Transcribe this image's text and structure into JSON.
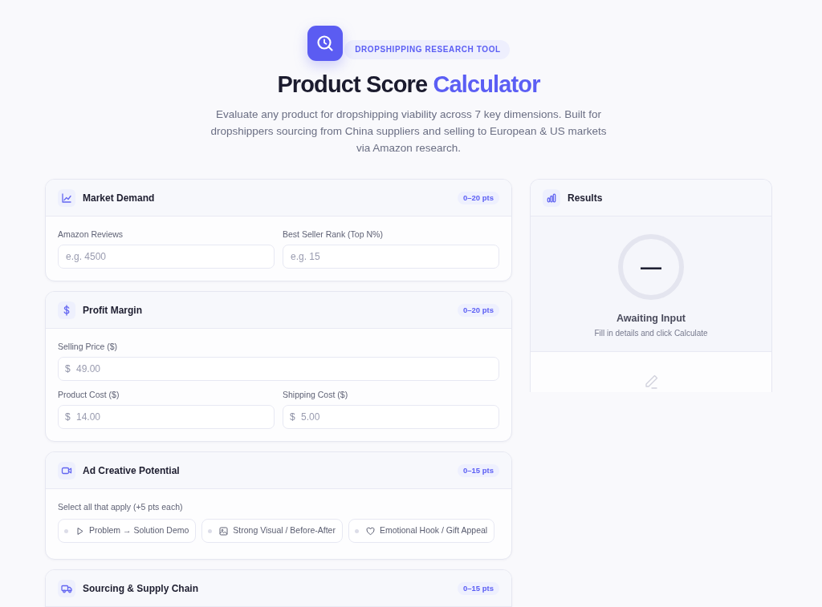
{
  "header": {
    "badge": "DROPSHIPPING RESEARCH TOOL",
    "title": "Product Score",
    "title_accent": "Calculator",
    "description": "Evaluate any product for dropshipping viability across 7 key dimensions. Built for dropshippers sourcing from China suppliers and selling to European & US markets via Amazon research."
  },
  "sections": [
    {
      "kind": "fields",
      "title": "Market Demand",
      "points": "0–20 pts",
      "rows": [
        [
          {
            "label": "Amazon Reviews",
            "placeholder": "e.g. 4500"
          },
          {
            "label": "Best Seller Rank (Top N%)",
            "placeholder": "e.g. 15"
          }
        ]
      ]
    },
    {
      "kind": "fields",
      "title": "Profit Margin",
      "points": "0–20 pts",
      "rows": [
        [
          {
            "label": "Selling Price ($)",
            "prefix": "$",
            "placeholder": "49.00"
          }
        ],
        [
          {
            "label": "Product Cost ($)",
            "prefix": "$",
            "placeholder": "14.00"
          },
          {
            "label": "Shipping Cost ($)",
            "prefix": "$",
            "placeholder": "5.00"
          }
        ]
      ]
    },
    {
      "kind": "options",
      "title": "Ad Creative Potential",
      "points": "0–15 pts",
      "hint": "Select all that apply (+5 pts each)",
      "options": [
        {
          "label": "Problem → Solution Demo",
          "checked": false
        },
        {
          "label": "Strong Visual / Before-After",
          "checked": false
        },
        {
          "label": "Emotional Hook / Gift Appeal",
          "checked": false
        }
      ]
    },
    {
      "kind": "fields",
      "title": "Sourcing & Supply Chain",
      "points": "0–15 pts"
    }
  ],
  "results": {
    "title": "Results",
    "score": "—",
    "status": "Awaiting Input",
    "hint": "Fill in details and click Calculate"
  }
}
